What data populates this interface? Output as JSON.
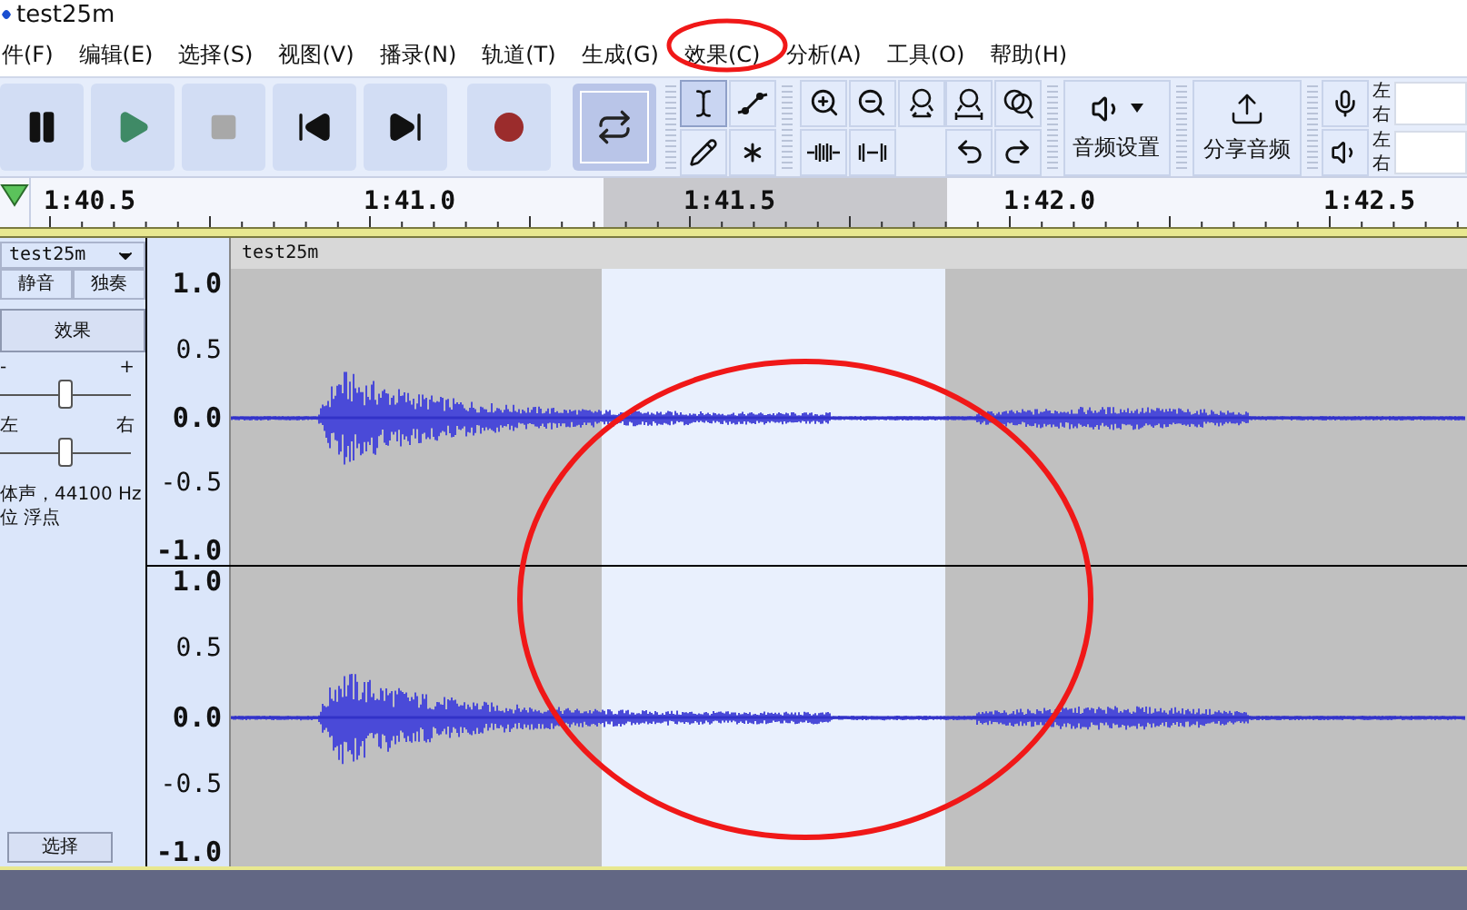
{
  "window": {
    "title": "test25m"
  },
  "menu": [
    {
      "label": "件(F)",
      "circled": false
    },
    {
      "label": "编辑(E)",
      "circled": false
    },
    {
      "label": "选择(S)",
      "circled": false
    },
    {
      "label": "视图(V)",
      "circled": false
    },
    {
      "label": "播录(N)",
      "circled": false
    },
    {
      "label": "轨道(T)",
      "circled": false
    },
    {
      "label": "生成(G)",
      "circled": false
    },
    {
      "label": "效果(C)",
      "circled": true
    },
    {
      "label": "分析(A)",
      "circled": false
    },
    {
      "label": "工具(O)",
      "circled": false
    },
    {
      "label": "帮助(H)",
      "circled": false
    }
  ],
  "transport": [
    {
      "kind": "pause"
    },
    {
      "kind": "play"
    },
    {
      "kind": "stop"
    },
    {
      "kind": "skip-start"
    },
    {
      "kind": "skip-end"
    },
    {
      "kind": "record"
    },
    {
      "kind": "loop",
      "selected": true
    }
  ],
  "tools": [
    {
      "kind": "select",
      "selected": true
    },
    {
      "kind": "envelope",
      "selected": false
    },
    {
      "kind": "draw",
      "selected": false
    },
    {
      "kind": "multi",
      "selected": false
    }
  ],
  "audio_setup": {
    "label": "音频设置"
  },
  "share": {
    "label": "分享音频"
  },
  "meters": [
    {
      "kind": "record",
      "left": "左",
      "right": "右"
    },
    {
      "kind": "play",
      "left": "左",
      "right": "右"
    }
  ],
  "ruler": {
    "labels": [
      "1:40.5",
      "1:41.0",
      "1:41.5",
      "1:42.0",
      "1:42.5"
    ]
  },
  "track": {
    "name": "test25m",
    "title": "test25m",
    "mute": "静音",
    "solo": "独奏",
    "effects": "效果",
    "gain": {
      "minus": "-",
      "plus": "+",
      "level": 0.5
    },
    "pan": {
      "left": "左",
      "right": "右",
      "level": 0.5
    },
    "info": [
      "体声，44100 Hz",
      "位 浮点"
    ],
    "select": "选择",
    "selection_circled": true,
    "channels": [
      {
        "axis": [
          "1.0",
          "0.5",
          "0.0",
          "-0.5",
          "-1.0"
        ]
      },
      {
        "axis": [
          "1.0",
          "0.5",
          "0.0",
          "-0.5",
          "-1.0"
        ]
      }
    ]
  }
}
